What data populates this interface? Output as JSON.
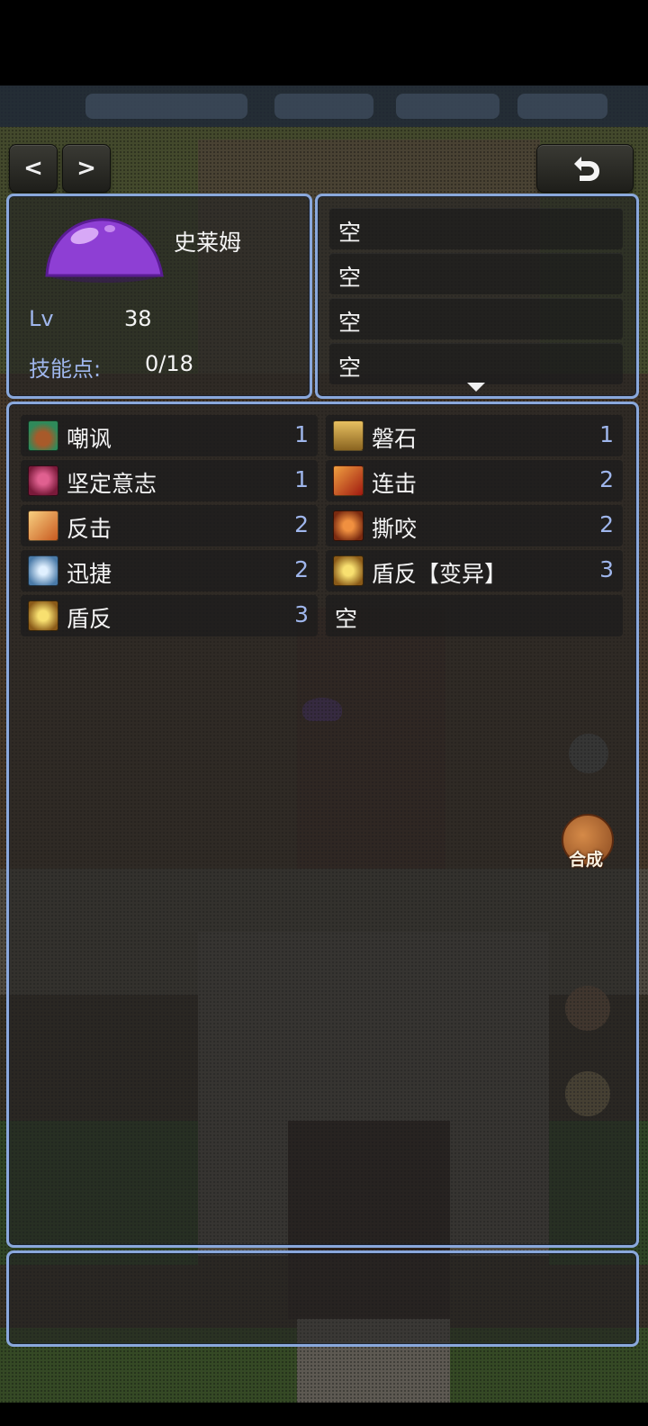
{
  "nav": {
    "prev_label": "<",
    "next_label": ">",
    "back_icon": "undo-arrow-icon"
  },
  "monster": {
    "name": "史莱姆",
    "icon": "purple-slime-icon",
    "level_label": "Lv",
    "level": "38",
    "skill_points_label": "技能点:",
    "skill_points": "0/18"
  },
  "slots": [
    {
      "label": "空"
    },
    {
      "label": "空"
    },
    {
      "label": "空"
    },
    {
      "label": "空"
    }
  ],
  "skills": [
    {
      "name": "嘲讽",
      "level": "1",
      "icon": "taunt-icon",
      "color": "#2f8a5a"
    },
    {
      "name": "磐石",
      "level": "1",
      "icon": "rock-icon",
      "color": "#b08a40"
    },
    {
      "name": "坚定意志",
      "level": "1",
      "icon": "will-icon",
      "color": "#b04070"
    },
    {
      "name": "连击",
      "level": "2",
      "icon": "combo-icon",
      "color": "#c84020"
    },
    {
      "name": "反击",
      "level": "2",
      "icon": "counter-icon",
      "color": "#d88030"
    },
    {
      "name": "撕咬",
      "level": "2",
      "icon": "bite-icon",
      "color": "#c86028"
    },
    {
      "name": "迅捷",
      "level": "2",
      "icon": "swift-icon",
      "color": "#6aa0c8"
    },
    {
      "name": "盾反【变异】",
      "level": "3",
      "icon": "shield-counter-mutant-icon",
      "color": "#c89030"
    },
    {
      "name": "盾反",
      "level": "3",
      "icon": "shield-counter-icon",
      "color": "#c89030"
    },
    {
      "name": "空",
      "level": "",
      "icon": "",
      "color": ""
    }
  ],
  "side": {
    "merge_label": "合成",
    "merge_icon": "yin-yang-icon"
  },
  "colors": {
    "panel_border": "#8aa8dc",
    "label_blue": "#9fb6ec"
  }
}
